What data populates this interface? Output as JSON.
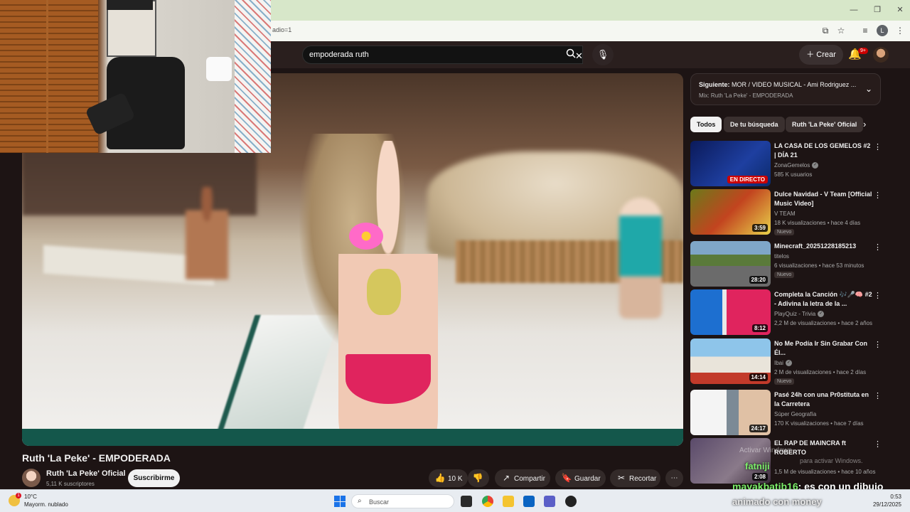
{
  "browser": {
    "url_fragment": "adio=1",
    "profile_initial": "L"
  },
  "youtube": {
    "search": {
      "value": "empoderada ruth"
    },
    "create_label": "Crear",
    "notifications_badge": "9+"
  },
  "video": {
    "title": "Ruth 'La Peke' - EMPODERADA",
    "channel_name": "Ruth 'La Peke' Oficial",
    "subscribers": "5,11 K suscriptores",
    "subscribe_label": "Suscribirme",
    "likes": "10 K",
    "share_label": "Compartir",
    "save_label": "Guardar",
    "clip_label": "Recortar"
  },
  "up_next": {
    "title_prefix": "Siguiente:",
    "title": "MOR / VIDEO MUSICAL - Ami Rodriguez ...",
    "mix": "Mix: Ruth 'La Peke' - EMPODERADA"
  },
  "chips": [
    "Todos",
    "De tu búsqueda",
    "Ruth 'La Peke' Oficial"
  ],
  "recommendations": [
    {
      "title": "LA CASA DE LOS GEMELOS #2 | DÍA 21",
      "channel": "ZonaGemelos",
      "verified": true,
      "meta": "585 K usuarios",
      "badge": "EN DIRECTO",
      "new": false
    },
    {
      "title": "Dulce Navidad - V Team [Official Music Video]",
      "channel": "V TEAM",
      "verified": false,
      "meta": "18 K visualizaciones • hace 4 días",
      "duration": "3:59",
      "new": true
    },
    {
      "title": "Minecraft_20251228185213",
      "channel": "titelos",
      "verified": false,
      "meta": "6 visualizaciones • hace 53 minutos",
      "duration": "28:20",
      "new": true
    },
    {
      "title": "Completa la Canción 🎶🎤🧠 #2 - Adivina la letra de la ...",
      "channel": "PlayQuiz - Trivia",
      "verified": true,
      "meta": "2,2 M de visualizaciones • hace 2 años",
      "duration": "8:12",
      "new": false
    },
    {
      "title": "No Me Podía Ir Sin Grabar Con Él...",
      "channel": "Ibai",
      "verified": true,
      "meta": "2 M de visualizaciones • hace 2 días",
      "duration": "14:14",
      "new": true
    },
    {
      "title": "Pasé 24h con una Pr0stituta en la Carretera",
      "channel": "Súper Geografía",
      "verified": false,
      "meta": "170 K visualizaciones • hace 7 días",
      "duration": "24:17",
      "new": false
    },
    {
      "title": "EL RAP DE MAINCRA ft ROBERTO",
      "channel": "",
      "verified": false,
      "meta": "1,5 M de visualizaciones • hace 10 años",
      "duration": "2:08",
      "new": false
    }
  ],
  "overlay": {
    "chat_user": "mayakbatib16",
    "chat_message": ": es con un dibujo",
    "chat_user2": "fatniji",
    "activate_windows": "Activar Windows",
    "activate_windows_sub": "para activar Windows.",
    "money_text": "animado con money"
  },
  "taskbar": {
    "temperature": "10°C",
    "condition": "Mayorm. nublado",
    "weather_badge": "1",
    "search_label": "Buscar",
    "time": "0:53",
    "date": "29/12/2025"
  },
  "colors": {
    "youtube_bg": "#1d1414",
    "live_red": "#cc0000",
    "chat_green": "#7cf06a",
    "chrome_tab_bar": "#d7e7c9"
  }
}
